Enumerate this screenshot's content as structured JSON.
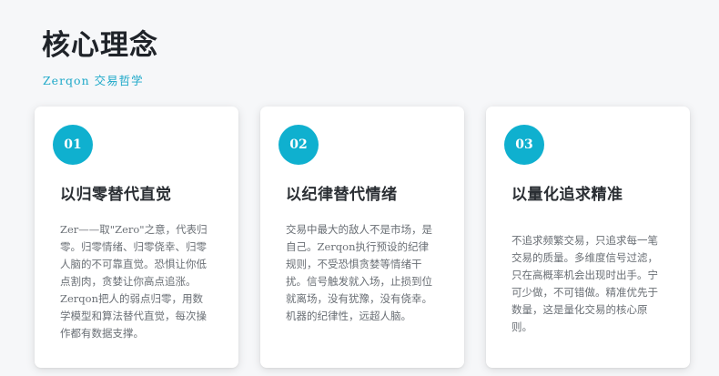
{
  "header": {
    "title": "核心理念",
    "subtitle": "Zerqon 交易哲学"
  },
  "cards": [
    {
      "number": "01",
      "title": "以归零替代直觉",
      "description": "Zer——取\"Zero\"之意，代表归零。归零情绪、归零侥幸、归零人脑的不可靠直觉。恐惧让你低点割肉，贪婪让你高点追涨。Zerqon把人的弱点归零，用数学模型和算法替代直觉，每次操作都有数据支撑。"
    },
    {
      "number": "02",
      "title": "以纪律替代情绪",
      "description": "交易中最大的敌人不是市场，是自己。Zerqon执行预设的纪律规则，不受恐惧贪婪等情绪干扰。信号触发就入场，止损到位就离场，没有犹豫，没有侥幸。机器的纪律性，远超人脑。"
    },
    {
      "number": "03",
      "title": "以量化追求精准",
      "description": "不追求频繁交易，只追求每一笔交易的质量。多维度信号过滤，只在高概率机会出现时出手。宁可少做，不可错做。精准优先于数量，这是量化交易的核心原则。"
    }
  ],
  "colors": {
    "accent": "#0fb0cf",
    "background": "#f6f7f9",
    "card": "#ffffff"
  }
}
